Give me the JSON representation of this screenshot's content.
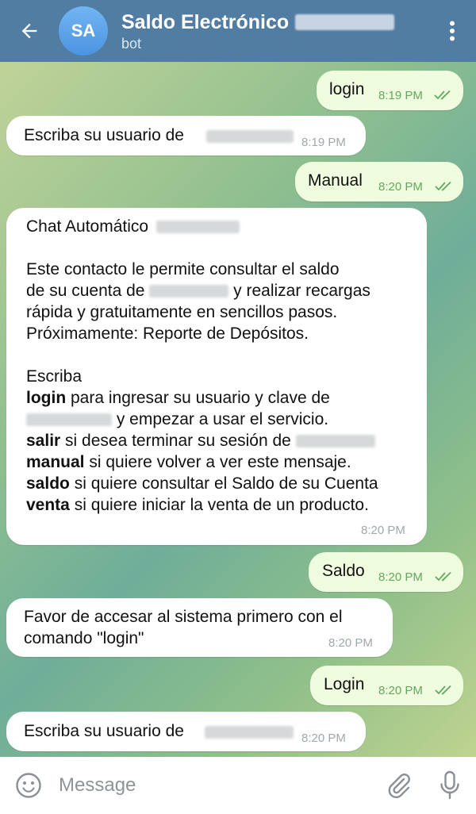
{
  "header": {
    "title": "Saldo Electrónico",
    "subtitle": "bot",
    "avatar_initials": "SA",
    "back_icon": "arrow-left-icon",
    "menu_icon": "more-vertical-icon"
  },
  "messages": [
    {
      "dir": "out",
      "text": "login",
      "time": "8:19 PM",
      "read": true
    },
    {
      "dir": "in",
      "text": "Escriba su usuario de",
      "time": "8:19 PM"
    },
    {
      "dir": "out",
      "text": "Manual",
      "time": "8:20 PM",
      "read": true
    },
    {
      "dir": "in",
      "type": "long",
      "line1": "Chat Automático",
      "line2": "Este contacto le permite consultar el saldo",
      "line3a": "de su cuenta de",
      "line3b": "y realizar recargas",
      "line4": "rápida y gratuitamente en sencillos pasos.",
      "line5": "Próximamente: Reporte de Depósitos.",
      "line6": "Escriba",
      "cmd_login": "login",
      "line7": "para ingresar su usuario y clave de",
      "line8": "y empezar a usar el servicio.",
      "cmd_salir": "salir",
      "line9": "si desea terminar su sesión de",
      "cmd_manual": "manual",
      "line10": "si quiere volver a ver este mensaje.",
      "cmd_saldo": "saldo",
      "line11": "si quiere consultar el Saldo de su Cuenta",
      "cmd_venta": "venta",
      "line12": "si quiere iniciar la venta de un producto.",
      "time": "8:20 PM"
    },
    {
      "dir": "out",
      "text": "Saldo",
      "time": "8:20 PM",
      "read": true
    },
    {
      "dir": "in",
      "line1": "Favor de accesar al sistema primero con el",
      "line2": "comando \"login\"",
      "time": "8:20 PM"
    },
    {
      "dir": "out",
      "text": "Login",
      "time": "8:20 PM",
      "read": true
    },
    {
      "dir": "in",
      "text": "Escriba su usuario de",
      "time": "8:20 PM"
    }
  ],
  "input": {
    "placeholder": "Message",
    "emoji_icon": "emoji-icon",
    "attach_icon": "paperclip-icon",
    "mic_icon": "microphone-icon"
  },
  "colors": {
    "header": "#527da3",
    "outgoing_bubble": "#effdde",
    "incoming_bubble": "#ffffff",
    "read_ticks": "#63a862"
  }
}
